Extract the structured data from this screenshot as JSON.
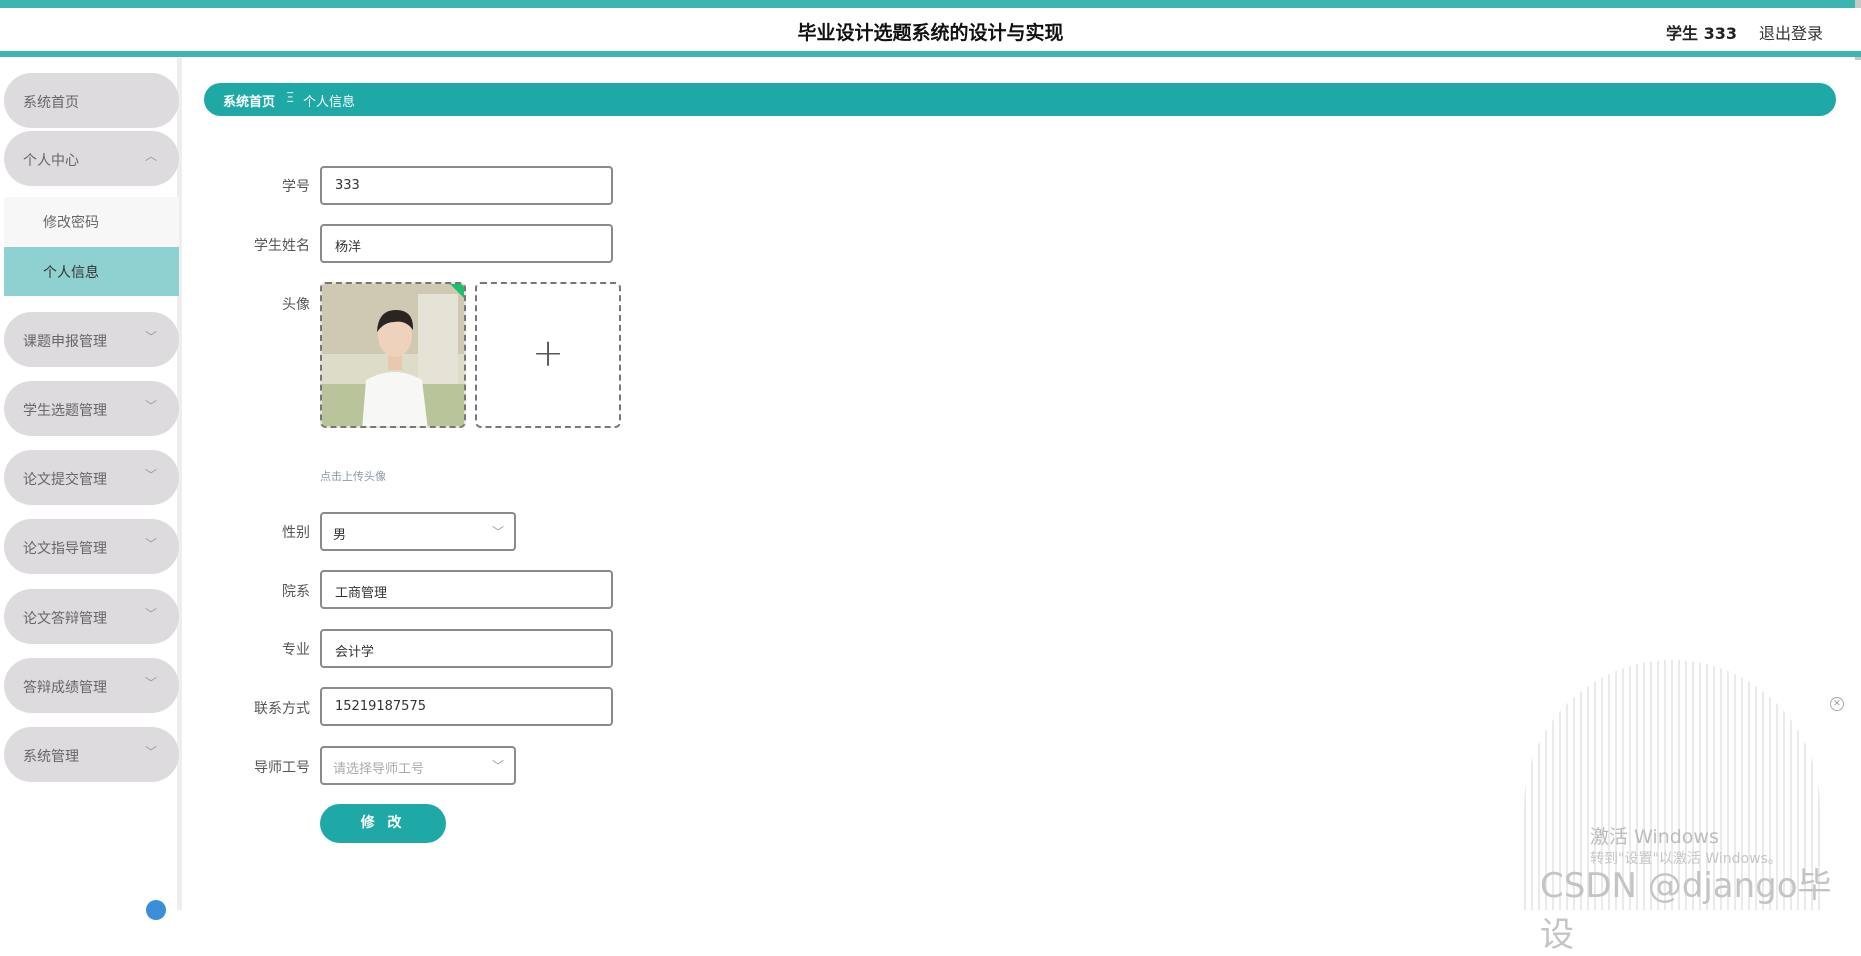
{
  "header": {
    "title": "毕业设计选题系统的设计与实现",
    "user": "学生 333",
    "logout": "退出登录"
  },
  "sidebar": {
    "items": [
      {
        "label": "系统首页"
      },
      {
        "label": "个人中心",
        "expanded": true,
        "children": [
          {
            "label": "修改密码"
          },
          {
            "label": "个人信息",
            "active": true
          }
        ]
      },
      {
        "label": "课题申报管理"
      },
      {
        "label": "学生选题管理"
      },
      {
        "label": "论文提交管理"
      },
      {
        "label": "论文指导管理"
      },
      {
        "label": "论文答辩管理"
      },
      {
        "label": "答辩成绩管理"
      },
      {
        "label": "系统管理"
      }
    ]
  },
  "breadcrumb": {
    "home": "系统首页",
    "separator": "Ξ",
    "current": "个人信息"
  },
  "form": {
    "student_id": {
      "label": "学号",
      "value": "333"
    },
    "student_name": {
      "label": "学生姓名",
      "value": "杨洋"
    },
    "avatar": {
      "label": "头像",
      "hint": "点击上传头像"
    },
    "gender": {
      "label": "性别",
      "value": "男"
    },
    "department": {
      "label": "院系",
      "value": "工商管理"
    },
    "major": {
      "label": "专业",
      "value": "会计学"
    },
    "phone": {
      "label": "联系方式",
      "value": "15219187575"
    },
    "advisor_id": {
      "label": "导师工号",
      "placeholder": "请选择导师工号"
    },
    "submit": "修 改"
  },
  "watermark": {
    "line1": "激活 Windows",
    "line2": "转到\"设置\"以激活 Windows。",
    "csdn": "CSDN @django毕设"
  },
  "colors": {
    "accent": "#1ea9a6",
    "topbar": "#3ab5b0",
    "active_sub": "#8fd1d1"
  }
}
